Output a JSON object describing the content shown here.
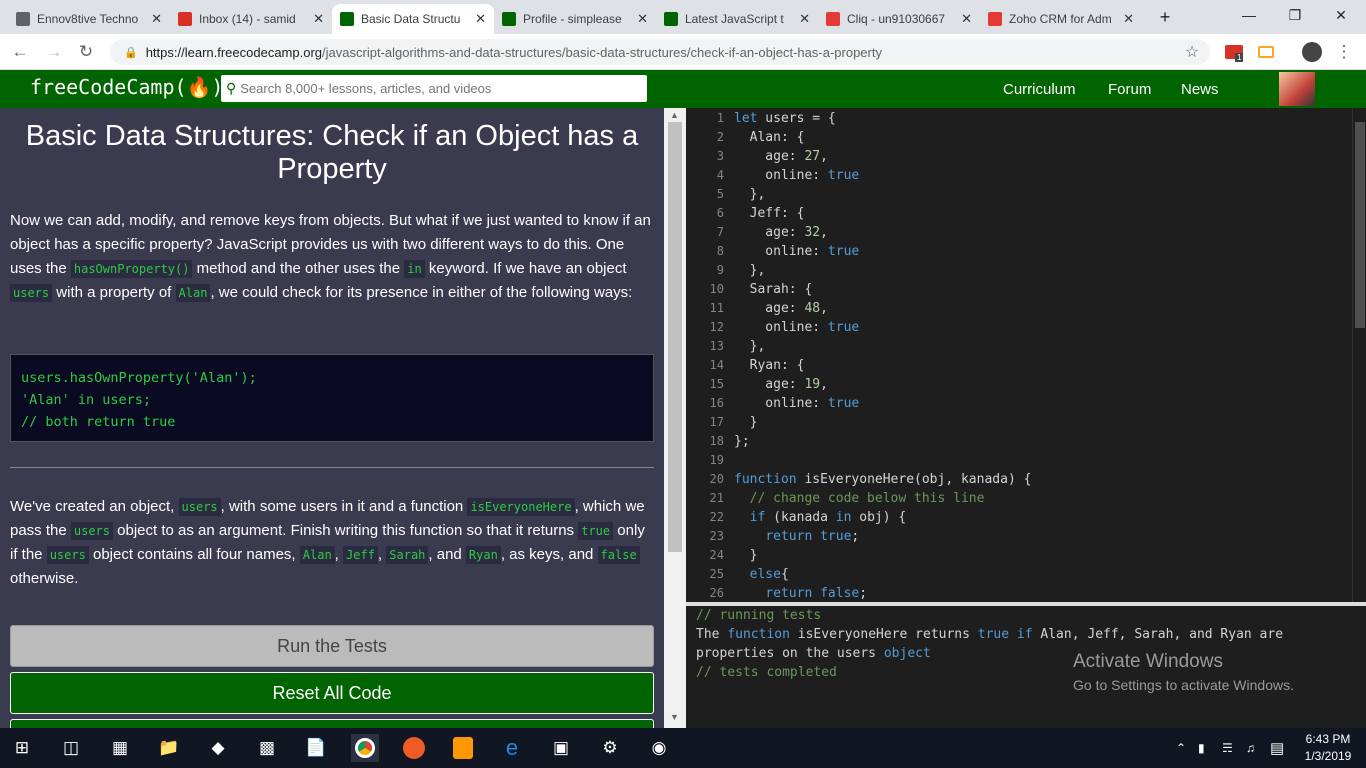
{
  "browser": {
    "tabs": [
      {
        "title": "Ennov8tive Techno",
        "favicon": "page-icon",
        "color": "#5f6368"
      },
      {
        "title": "Inbox (14) - samid",
        "favicon": "gmail-icon",
        "color": "#d93025"
      },
      {
        "title": "Basic Data Structu",
        "favicon": "fcc-icon",
        "color": "#006400",
        "active": true
      },
      {
        "title": "Profile - simplease",
        "favicon": "fcc-icon",
        "color": "#006400"
      },
      {
        "title": "Latest JavaScript t",
        "favicon": "fcc-icon",
        "color": "#006400"
      },
      {
        "title": "Cliq - un91030667",
        "favicon": "cliq-icon",
        "color": "#e53935"
      },
      {
        "title": "Zoho CRM for Adm",
        "favicon": "zoho-icon",
        "color": "#e53935"
      }
    ],
    "new_tab": "+",
    "url_host": "https://learn.freecodecamp.org",
    "url_path": "/javascript-algorithms-and-data-structures/basic-data-structures/check-if-an-object-has-a-property",
    "ext_badge": "1"
  },
  "fcc": {
    "logo": "freeCodeCamp(🔥)",
    "search_placeholder": "Search 8,000+ lessons, articles, and videos",
    "nav": [
      "Curriculum",
      "Forum",
      "News"
    ]
  },
  "lesson": {
    "title": "Basic Data Structures: Check if an Object has a Property",
    "p1": [
      "Now we can add, modify, and remove keys from objects. But what if we just wanted to know if an object has a specific property? JavaScript provides us with two different ways to do this. One uses the ",
      "hasOwnProperty()",
      " method and the other uses the ",
      "in",
      " keyword. If we have an object ",
      "users",
      " with a property of ",
      "Alan",
      ", we could check for its presence in either of the following ways:"
    ],
    "code": [
      "users.hasOwnProperty('Alan');",
      "'Alan' in users;",
      "// both return true"
    ],
    "p2": [
      "We've created an object, ",
      "users",
      ", with some users in it and a function ",
      "isEveryoneHere",
      ", which we pass the ",
      "users",
      " object to as an argument. Finish writing this function so that it returns ",
      "true",
      " only if the ",
      "users",
      " object contains all four names, ",
      "Alan",
      ", ",
      "Jeff",
      ", ",
      "Sarah",
      ", and ",
      "Ryan",
      ", as keys, and ",
      "false",
      " otherwise."
    ],
    "run_button": "Run the Tests",
    "reset_button": "Reset All Code"
  },
  "editor": {
    "lines": [
      "let users = {",
      "  Alan: {",
      "    age: 27,",
      "    online: true",
      "  },",
      "  Jeff: {",
      "    age: 32,",
      "    online: true",
      "  },",
      "  Sarah: {",
      "    age: 48,",
      "    online: true",
      "  },",
      "  Ryan: {",
      "    age: 19,",
      "    online: true",
      "  }",
      "};",
      "",
      "function isEveryoneHere(obj, kanada) {",
      "  // change code below this line",
      "  if (kanada in obj) {",
      "    return true;",
      "  }",
      "  else{",
      "    return false;"
    ]
  },
  "console": {
    "l1": "// running tests",
    "l2": "The function isEveryoneHere returns true if Alan, Jeff, Sarah, and Ryan are",
    "l3": "properties on the users object",
    "l4": "// tests completed"
  },
  "watermark": {
    "title": "Activate Windows",
    "sub": "Go to Settings to activate Windows."
  },
  "taskbar": {
    "time": "6:43 PM",
    "date": "1/3/2019"
  }
}
